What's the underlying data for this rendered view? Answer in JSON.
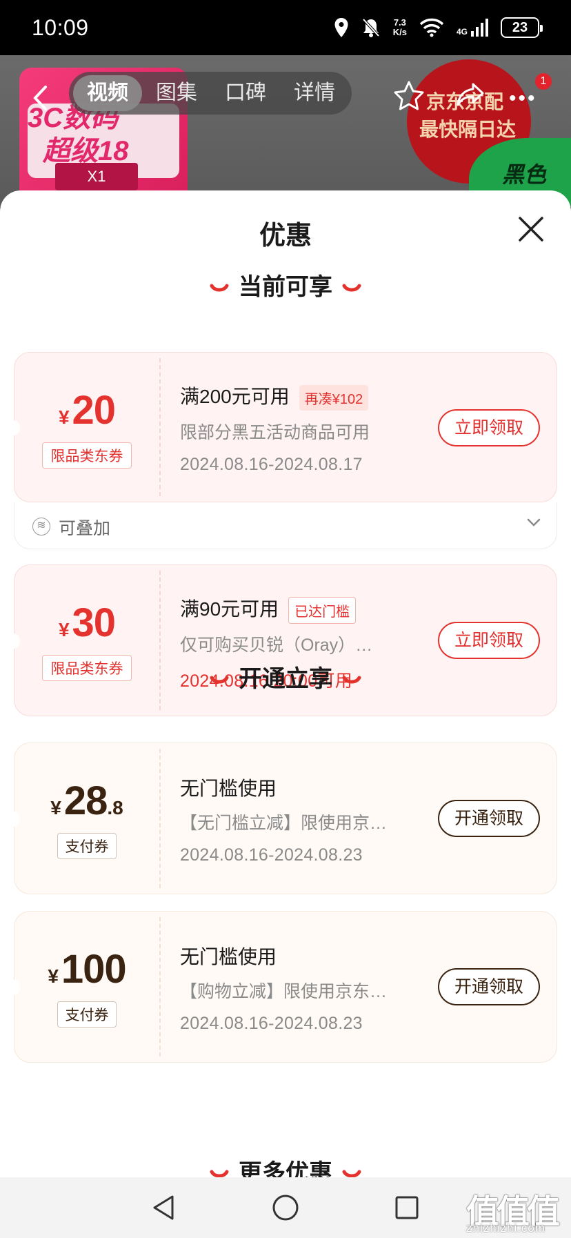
{
  "status": {
    "time": "10:09",
    "net_speed": "7.3",
    "net_unit": "K/s",
    "signal": "4G",
    "battery": "23"
  },
  "header": {
    "tabs": [
      "视频",
      "图集",
      "口碑",
      "详情"
    ],
    "notification_count": "1",
    "promo_line1": "3C数码",
    "promo_line2": "超级18",
    "promo_x1": "X1",
    "badge_line1": "京东京配",
    "badge_line2": "最快隔日达",
    "green_tag": "黑色"
  },
  "sheet": {
    "title": "优惠",
    "section_current": "当前可享",
    "section_open": "开通立享",
    "section_more": "更多优惠"
  },
  "coupons": [
    {
      "currency": "¥",
      "amount": "20",
      "type": "限品类东券",
      "title": "满200元可用",
      "tag": "再凑¥102",
      "desc": "限部分黑五活动商品可用",
      "date": "2024.08.16-2024.08.17",
      "button": "立即领取"
    },
    {
      "currency": "¥",
      "amount": "30",
      "type": "限品类东券",
      "title": "满90元可用",
      "tag": "已达门槛",
      "desc": "仅可购买贝锐（Oray）京…",
      "date": "2024.08.16 20:00可用",
      "button": "立即领取"
    },
    {
      "currency": "¥",
      "amount": "28",
      "amount_decimal": ".8",
      "type": "支付券",
      "title": "无门槛使用",
      "desc": "【无门槛立减】限使用京…",
      "date": "2024.08.16-2024.08.23",
      "button": "开通领取"
    },
    {
      "currency": "¥",
      "amount": "100",
      "type": "支付券",
      "title": "无门槛使用",
      "desc": "【购物立减】限使用京东…",
      "date": "2024.08.16-2024.08.23",
      "button": "开通领取"
    }
  ],
  "stack": {
    "label": "可叠加",
    "icon_glyph": "≋"
  },
  "watermark": {
    "text": "值值值",
    "url": "zhizhizhi.com"
  },
  "colors": {
    "accent_red": "#e4322f",
    "brown": "#3a2310"
  }
}
